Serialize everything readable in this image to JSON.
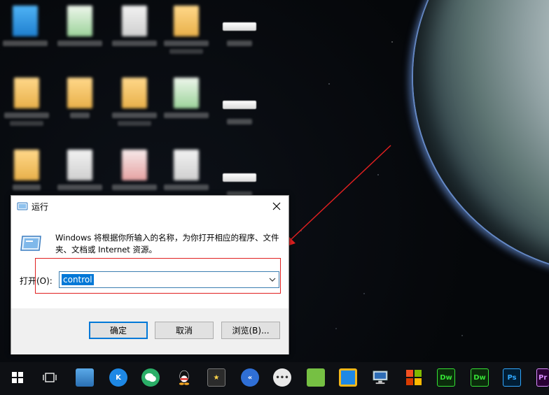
{
  "run_dialog": {
    "title": "运行",
    "description": "Windows 将根据你所输入的名称，为你打开相应的程序、文件夹、文档或 Internet 资源。",
    "open_label": "打开(O):",
    "open_value": "control",
    "ok_label": "确定",
    "cancel_label": "取消",
    "browse_label": "浏览(B)...",
    "highlight_color": "#e02020",
    "selection_color": "#0078d7"
  },
  "desktop": {
    "annotation_arrow_color": "#e02020",
    "icons": [
      "folder-icon",
      "excel-file-icon",
      "document-icon",
      "document-icon",
      "shortcut-bar-icon",
      "folder-icon",
      "folder-icon",
      "folder-icon",
      "excel-file-icon",
      "shortcut-bar-icon",
      "document-icon",
      "document-icon",
      "pdf-file-icon",
      "document-icon",
      "shortcut-bar-icon"
    ]
  },
  "taskbar": {
    "items": [
      "windows-start-icon",
      "task-view-icon",
      "network-icon",
      "k-app-icon",
      "wechat-icon",
      "qq-icon",
      "star-app-icon",
      "arrow-app-icon",
      "chat-app-icon",
      "green-app-icon",
      "package-app-icon",
      "monitor-app-icon",
      "tiles-app-icon",
      "dreamweaver-icon",
      "dreamweaver-icon",
      "photoshop-icon",
      "premiere-icon"
    ],
    "labels": {
      "k": "K",
      "dw": "Dw",
      "ps": "Ps",
      "pr": "Pr"
    }
  }
}
